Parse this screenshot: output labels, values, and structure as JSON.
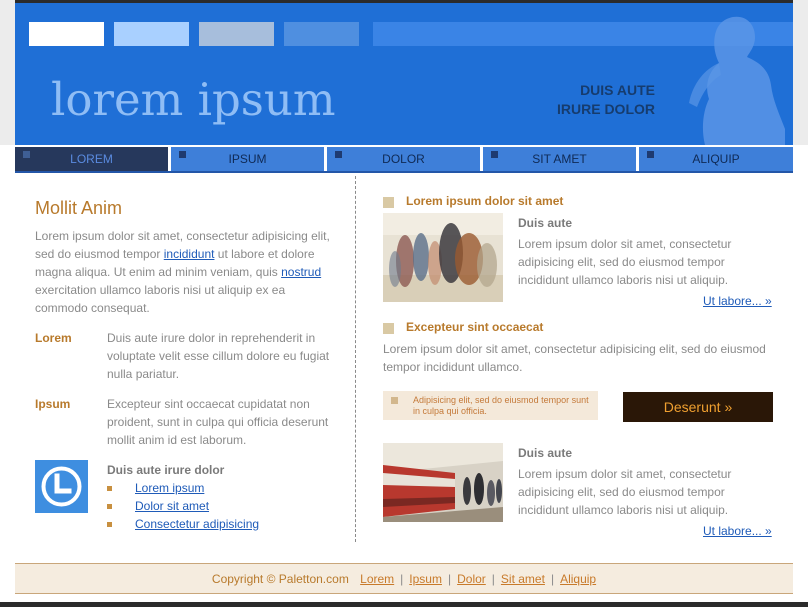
{
  "header": {
    "site_title": "lorem ipsum",
    "slogan_line1": "DUIS AUTE",
    "slogan_line2": "IRURE DOLOR",
    "swatch_colors": [
      "#ffffff",
      "#a9d0ff",
      "#a7bedc",
      "#4f8fe0"
    ]
  },
  "nav": {
    "items": [
      {
        "label": "LOREM",
        "active": true
      },
      {
        "label": "IPSUM",
        "active": false
      },
      {
        "label": "DOLOR",
        "active": false
      },
      {
        "label": "SIT AMET",
        "active": false
      },
      {
        "label": "ALIQUIP",
        "active": false
      }
    ]
  },
  "left": {
    "title": "Mollit Anim",
    "intro_part1": "Lorem ipsum dolor sit amet, consectetur adipisicing elit, sed do eiusmod tempor",
    "intro_link1": "incididunt",
    "intro_part2": "ut labore et dolore magna aliqua. Ut enim ad minim veniam, quis",
    "intro_link2": "nostrud",
    "intro_part3": "exercitation ullamco laboris nisi ut aliquip ex ea commodo consequat.",
    "defs": [
      {
        "term": "Lorem",
        "text": "Duis aute irure dolor in reprehenderit in voluptate velit esse cillum dolore eu fugiat nulla pariatur."
      },
      {
        "term": "Ipsum",
        "text": "Excepteur sint occaecat cupidatat non proident, sunt in culpa qui officia deserunt mollit anim id est laborum."
      }
    ],
    "list_heading": "Duis aute irure dolor",
    "list_links": [
      "Lorem ipsum",
      "Dolor sit amet",
      "Consectetur adipisicing"
    ]
  },
  "right": {
    "section1_title": "Lorem ipsum dolor sit amet",
    "item1_heading": "Duis aute",
    "item1_text": "Lorem ipsum dolor sit amet, consectetur adipisicing elit, sed do eiusmod tempor incididunt ullamco laboris nisi ut aliquip.",
    "item1_more": "Ut labore... »",
    "section2_title": "Excepteur sint occaecat",
    "section2_text": "Lorem ipsum dolor sit amet, consectetur adipisicing elit, sed do eiusmod tempor incididunt ullamco.",
    "note_text": "Adipisicing elit, sed do eiusmod tempor sunt in culpa qui officia.",
    "cta_label": "Deserunt »",
    "item2_heading": "Duis aute",
    "item2_text": "Lorem ipsum dolor sit amet, consectetur adipisicing elit, sed do eiusmod tempor incididunt ullamco laboris nisi ut aliquip.",
    "item2_more": "Ut labore... »"
  },
  "footer": {
    "copyright": "Copyright © Paletton.com",
    "links": [
      "Lorem",
      "Ipsum",
      "Dolor",
      "Sit amet",
      "Aliquip"
    ]
  }
}
